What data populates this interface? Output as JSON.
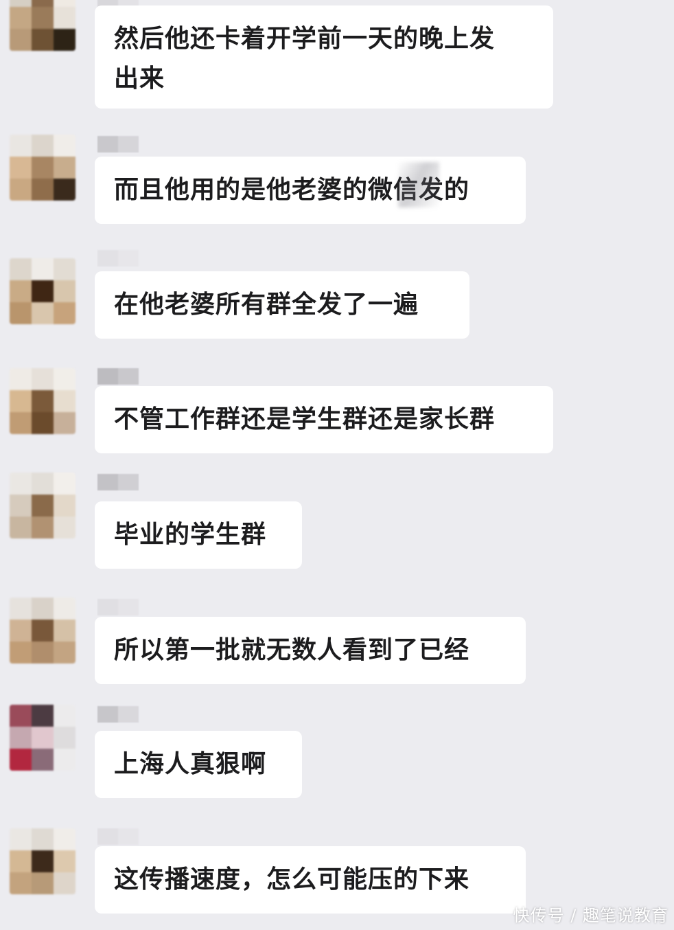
{
  "messages": [
    {
      "text": "然后他还卡着开学前一天的晚上发\n出来"
    },
    {
      "text": "而且他用的是他老婆的微信发的"
    },
    {
      "text": "在他老婆所有群全发了一遍"
    },
    {
      "text": "不管工作群还是学生群还是家长群"
    },
    {
      "text": "毕业的学生群"
    },
    {
      "text": "所以第一批就无数人看到了已经"
    },
    {
      "text": "上海人真狠啊"
    },
    {
      "text": "这传播速度，怎么可能压的下来"
    }
  ],
  "avatars": [
    {
      "colors": [
        "#d6cfc4",
        "#8a6a4c",
        "#efeae3",
        "#c4a784",
        "#9a7b5a",
        "#e7e1d9",
        "#b89a78",
        "#6e5234",
        "#2d2316"
      ]
    },
    {
      "colors": [
        "#e9e6e2",
        "#dcd5cc",
        "#f0ede9",
        "#d8b894",
        "#a88663",
        "#c8ad8d",
        "#c9a882",
        "#8f6d4b",
        "#3a2a1c"
      ]
    },
    {
      "colors": [
        "#ddd6cc",
        "#efece8",
        "#e2dcd3",
        "#c9ab86",
        "#3f2614",
        "#d8c6ad",
        "#b9956c",
        "#d9c6ad",
        "#c7a37c"
      ]
    },
    {
      "colors": [
        "#efebe6",
        "#e6e0d9",
        "#f1eee9",
        "#d7b891",
        "#7b5a3a",
        "#e7ddcf",
        "#c09c74",
        "#6b4b2c",
        "#c7b09a"
      ]
    },
    {
      "colors": [
        "#eae7e3",
        "#e2ded8",
        "#f2efeb",
        "#d6cbbd",
        "#8a6a4a",
        "#e3d8c9",
        "#c8b6a0",
        "#b19272",
        "#e6e0d8"
      ]
    },
    {
      "colors": [
        "#e6e2dd",
        "#d9d2c9",
        "#eeebe7",
        "#cfb395",
        "#79583a",
        "#d5c1a7",
        "#c19d76",
        "#b08e6c",
        "#c3a482"
      ]
    },
    {
      "colors": [
        "#9a4b5a",
        "#4c3b42",
        "#ecebec",
        "#c5a8b0",
        "#e1c7ce",
        "#dedcdd",
        "#b2273f",
        "#8a6b78",
        "#ecebec"
      ]
    },
    {
      "colors": [
        "#eae7e3",
        "#dfdad3",
        "#f0ede9",
        "#d4b894",
        "#3d2a1b",
        "#ddc9ae",
        "#c3a37e",
        "#b79a78",
        "#ded5ca"
      ]
    }
  ],
  "nicknames": [
    {
      "colors": [
        "#d8d7db",
        "#e3e2e6"
      ]
    },
    {
      "colors": [
        "#c9c8cc",
        "#d6d5d9"
      ]
    },
    {
      "colors": [
        "#e2e1e5",
        "#e7e6ea"
      ]
    },
    {
      "colors": [
        "#bdbcc0",
        "#c9c8cc"
      ]
    },
    {
      "colors": [
        "#c3c2c6",
        "#d0cfd3"
      ]
    },
    {
      "colors": [
        "#e0dfe3",
        "#e5e4e8"
      ]
    },
    {
      "colors": [
        "#c7c6ca",
        "#d9d8dc"
      ]
    },
    {
      "colors": [
        "#e1e0e4",
        "#e6e5e9"
      ]
    }
  ],
  "watermark": "快传号 / 趣笔说教育"
}
